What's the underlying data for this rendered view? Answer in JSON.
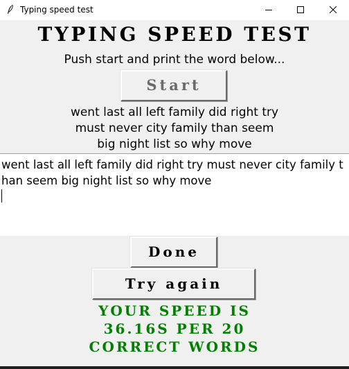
{
  "window": {
    "title": "Typing speed test",
    "icon": "feather-icon",
    "controls": [
      "minimize-icon",
      "maximize-icon",
      "close-icon"
    ]
  },
  "app": {
    "heading": "Typing speed test",
    "instruction": "Push start and print the word below...",
    "start_label": "Start",
    "target_lines": [
      "went last all left family did right try",
      "must never city family than seem",
      "big night list so why move"
    ],
    "typed_text": "went last all left family did right try must never city family than seem big night list so why move",
    "done_label": "Done",
    "try_again_label": "Try again",
    "result_lines": [
      "Your speed is",
      "36.16s per 20",
      "correct words"
    ]
  },
  "colors": {
    "background": "#f0f0f0",
    "start_text": "#6b6b6b",
    "result_text": "#008000",
    "entry_background": "#ffffff"
  }
}
